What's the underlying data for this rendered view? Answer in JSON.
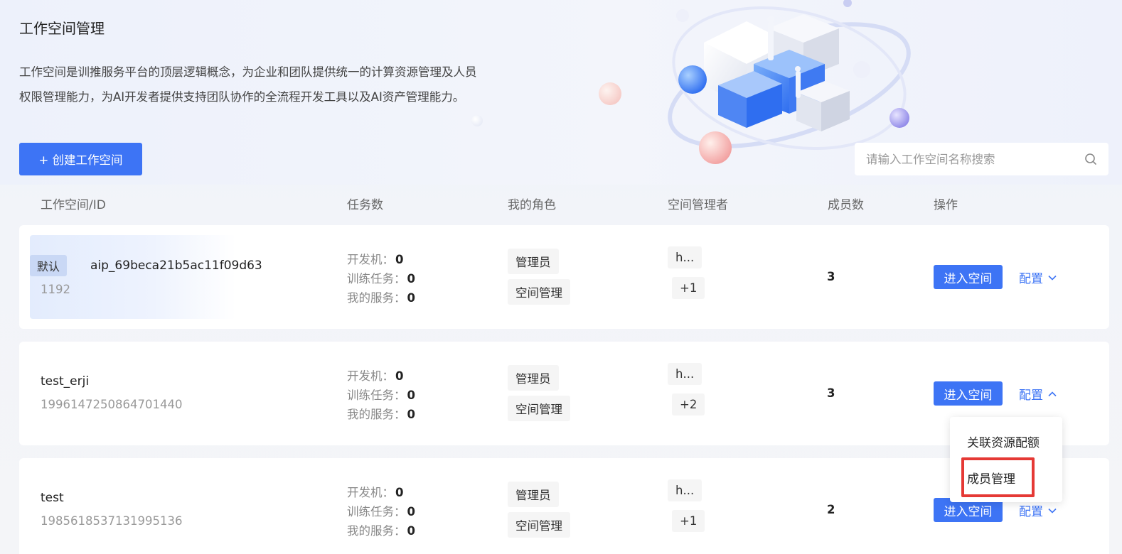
{
  "header": {
    "title": "工作空间管理",
    "desc_line1": "工作空间是训推服务平台的顶层逻辑概念，为企业和团队提供统一的计算资源管理及人员",
    "desc_line2": "权限管理能力，为AI开发者提供支持团队协作的全流程开发工具以及AI资产管理能力。"
  },
  "toolbar": {
    "create_label": "+ 创建工作空间",
    "search_placeholder": "请输入工作空间名称搜索"
  },
  "columns": {
    "workspace": "工作空间/ID",
    "tasks": "任务数",
    "role": "我的角色",
    "managers": "空间管理者",
    "members": "成员数",
    "actions": "操作"
  },
  "labels": {
    "dev": "开发机：",
    "train": "训练任务：",
    "service": "我的服务：",
    "enter": "进入空间",
    "config": "配置"
  },
  "rows": [
    {
      "badge": "默认",
      "name": "aip_69beca21b5ac11f09d63",
      "id": "1192",
      "dev": "0",
      "train": "0",
      "service": "0",
      "role1": "管理员",
      "role2": "空间管理",
      "manager": "h...",
      "manager_more": "+1",
      "members": "3",
      "expanded": false
    },
    {
      "badge": "",
      "name": "test_erji",
      "id": "1996147250864701440",
      "dev": "0",
      "train": "0",
      "service": "0",
      "role1": "管理员",
      "role2": "空间管理",
      "manager": "h...",
      "manager_more": "+2",
      "members": "3",
      "expanded": true
    },
    {
      "badge": "",
      "name": "test",
      "id": "1985618537131995136",
      "dev": "0",
      "train": "0",
      "service": "0",
      "role1": "管理员",
      "role2": "空间管理",
      "manager": "h...",
      "manager_more": "+1",
      "members": "2",
      "expanded": false
    }
  ],
  "dropdown": {
    "item1": "关联资源配额",
    "item2": "成员管理"
  },
  "colors": {
    "primary": "#3d74f5",
    "highlight": "#e53935"
  }
}
